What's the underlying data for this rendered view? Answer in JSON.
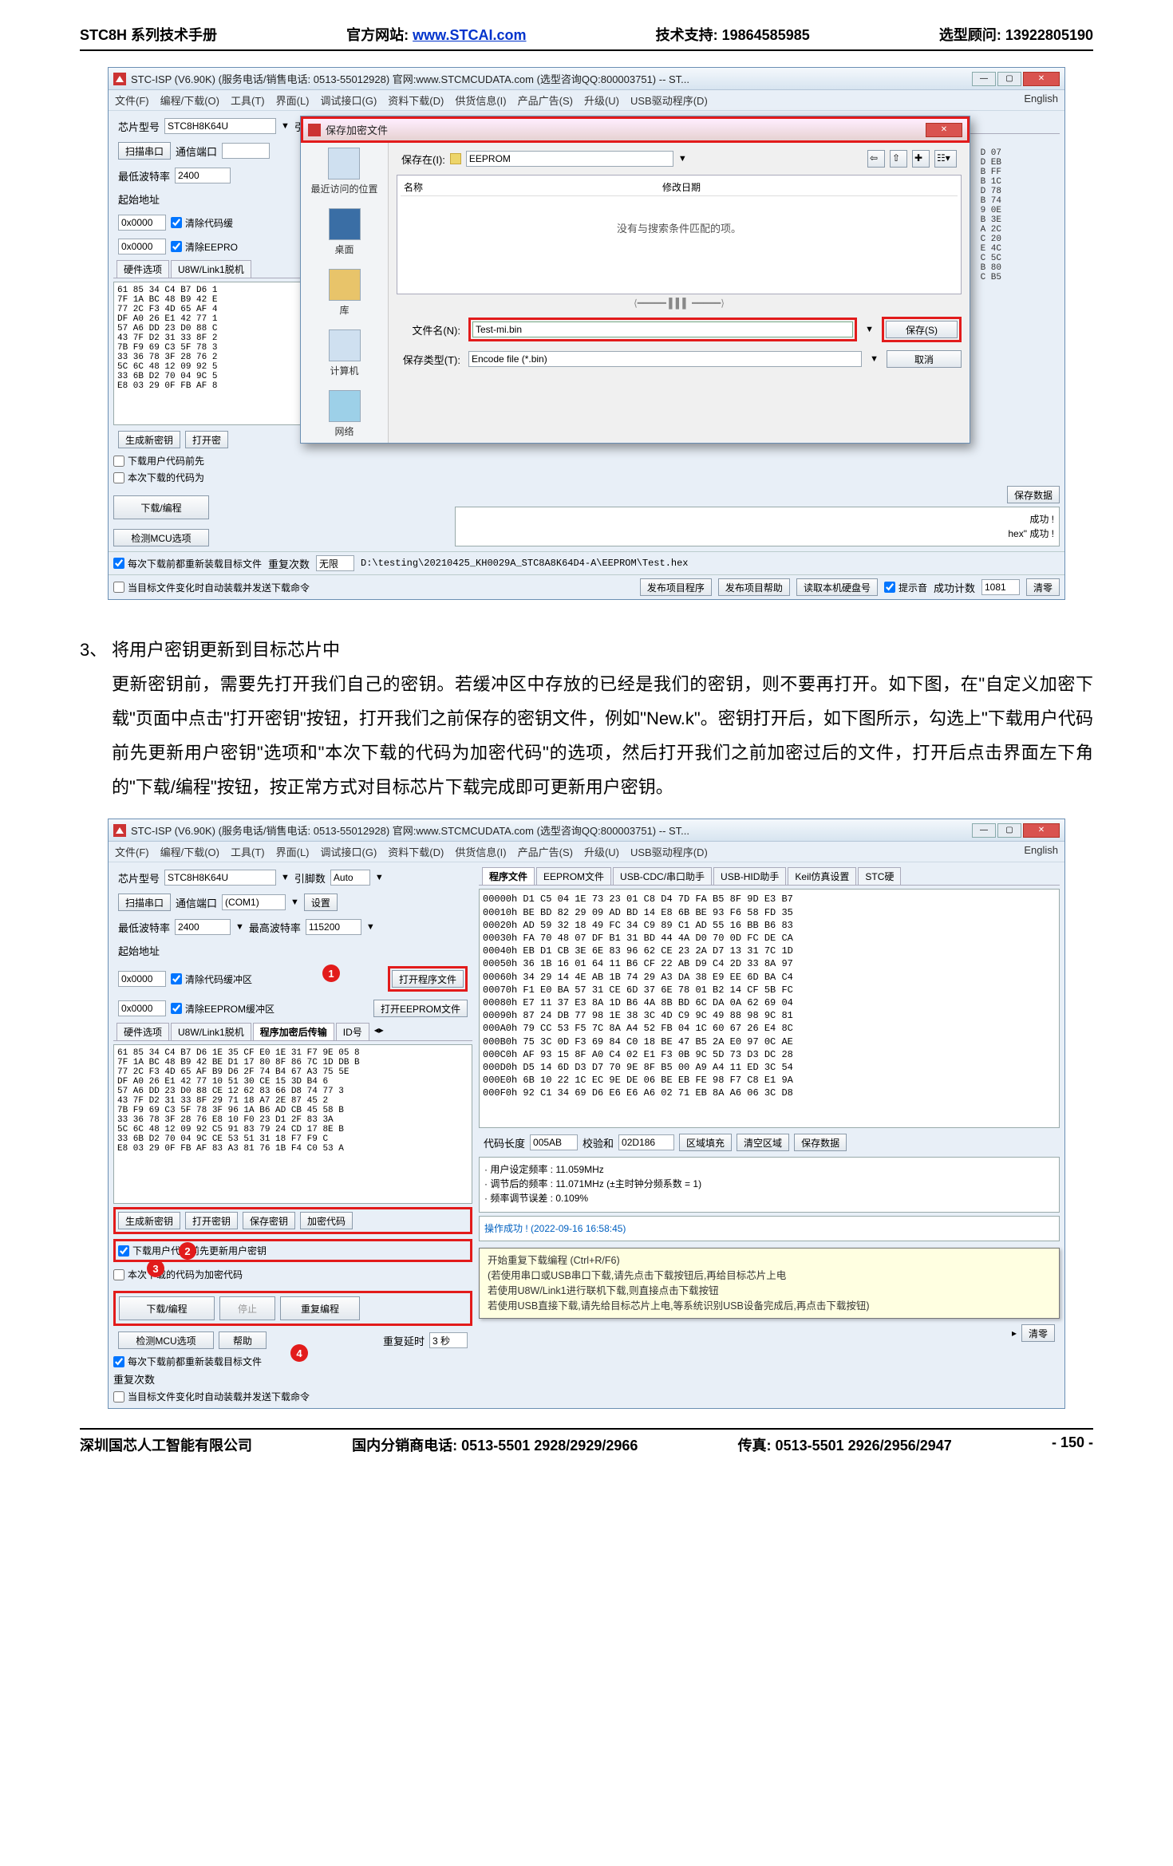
{
  "header": {
    "manual": "STC8H 系列技术手册",
    "site_label": "官方网站: ",
    "site_url": "www.STCAI.com",
    "support": "技术支持: 19864585985",
    "consultant": "选型顾问: 13922805190"
  },
  "footer": {
    "company": "深圳国芯人工智能有限公司",
    "distributor": "国内分销商电话: 0513-5501 2928/2929/2966",
    "fax": "传真: 0513-5501 2926/2956/2947",
    "page": "- 150 -"
  },
  "win_title": "STC-ISP (V6.90K) (服务电话/销售电话: 0513-55012928)  官网:www.STCMCUDATA.com  (选型咨询QQ:800003751) -- ST...",
  "menubar": [
    "文件(F)",
    "编程/下载(O)",
    "工具(T)",
    "界面(L)",
    "调试接口(G)",
    "资料下载(D)",
    "供货信息(I)",
    "产品广告(S)",
    "升级(U)",
    "USB驱动程序(D)",
    "English"
  ],
  "chip_label": "芯片型号",
  "chip_value": "STC8H8K64U",
  "pins_label": "引脚数",
  "pins_value": "Auto",
  "scan_port": "扫描串口",
  "com_port_label": "通信端口",
  "com_port_value": "(COM1)",
  "settings_btn": "设置",
  "min_baud_label": "最低波特率",
  "min_baud_value": "2400",
  "max_baud_label": "最高波特率",
  "max_baud_value": "115200",
  "start_addr_label": "起始地址",
  "addr1": "0x0000",
  "addr2": "0x0000",
  "clear_code_buf": "清除代码缓冲区",
  "clear_eeprom_buf": "清除EEPROM缓冲区",
  "open_prog_file": "打开程序文件",
  "open_eeprom_file": "打开EEPROM文件",
  "hw_tab": "硬件选项",
  "u8w_tab": "U8W/Link1脱机",
  "enc_tab": "程序加密后传输",
  "id_tab": "ID号",
  "hex_block1": "61 85 34 C4 B7 D6 1\n7F 1A BC 48 B9 42 E\n77 2C F3 4D 65 AF 4\nDF A0 26 E1 42 77 1\n57 A6 DD 23 D0 88 C\n43 7F D2 31 33 8F 2\n7B F9 69 C3 5F 78 3\n33 36 78 3F 28 76 2\n5C 6C 48 12 09 92 5\n33 6B D2 70 04 9C 5\nE8 03 29 0F FB AF 8",
  "hex_block2": "61 85 34 C4 B7 D6 1E 35 CF E0 1E 31 F7 9E 05 8\n7F 1A BC 48 B9 42 BE D1 17 80 8F 86 7C 1D DB B\n77 2C F3 4D 65 AF B9 D6 2F 74 B4 67 A3 75 5E\nDF A0 26 E1 42 77 10 51 30 CE 15 3D B4 6\n57 A6 DD 23 D0 88 CE 12 62 83 66 D8 74 77 3\n43 7F D2 31 33 8F 29 71 18 A7 2E 87 45 2\n7B F9 69 C3 5F 78 3F 96 1A B6 AD CB 45 58 B\n33 36 78 3F 28 76 E8 10 F0 23 D1 2F 83 3A\n5C 6C 48 12 09 92 C5 91 83 79 24 CD 17 8E B\n33 6B D2 70 04 9C CE 53 51 31 18 F7 F9 C\nE8 03 29 0F FB AF 83 A3 81 76 1B F4 C0 53 A",
  "right_hex_hdr": "00000h D1 C5 04 1E 73 23 01 C8 D4 7D FA B5 8F 9D E3 B7\n00010h BE BD 82 29 09 AD BD 14 E8 6B BE 93 F6 58 FD 35\n00020h AD 59 32 18 49 FC 34 C9 89 C1 AD 55 16 BB B6 83\n00030h FA 70 48 07 DF B1 31 BD 44 4A D0 70 0D FC DE CA\n00040h EB D1 CB 3E 6E 83 96 62 CE 23 2A D7 13 31 7C 1D\n00050h 36 1B 16 01 64 11 B6 CF 22 AB D9 C4 2D 33 8A 97\n00060h 34 29 14 4E AB 1B 74 29 A3 DA 38 E9 EE 6D BA C4\n00070h F1 E0 BA 57 31 CE 6D 37 6E 78 01 B2 14 CF 5B FC\n00080h E7 11 37 E3 8A 1D B6 4A 8B BD 6C DA 0A 62 69 04\n00090h 87 24 DB 77 98 1E 38 3C 4D C9 9C 49 88 98 9C 81\n000A0h 79 CC 53 F5 7C 8A A4 52 FB 04 1C 60 67 26 E4 8C\n000B0h 75 3C 0D F3 69 84 C0 18 BE 47 B5 2A E0 97 0C AE\n000C0h AF 93 15 8F A0 C4 02 E1 F3 0B 9C 5D 73 D3 DC 28\n000D0h D5 14 6D D3 D7 70 9E 8F B5 00 A9 A4 11 ED 3C 54\n000E0h 6B 10 22 1C EC 9E DE 06 BE EB FE 98 F7 C8 E1 9A\n000F0h 92 C1 34 69 D6 E6 E6 A6 02 71 EB 8A A6 06 3C D8",
  "gen_key": "生成新密钥",
  "open_key": "打开密钥",
  "save_key": "保存密钥",
  "enc_code": "加密代码",
  "download_btn": "下载/编程",
  "stop_btn": "停止",
  "reprogram_btn": "重复编程",
  "detect_mcu": "检测MCU选项",
  "help_btn": "帮助",
  "retry_label": "重复次数",
  "retry_infinite": "无限",
  "retry_delay_label": "重复延时",
  "retry_delay_value": "3 秒",
  "chk_reinstall": "每次下载前都重新装载目标文件",
  "chk_autoload": "当目标文件变化时自动装载并发送下载命令",
  "chk_update_key": "下载用户代码前先更新用户密钥",
  "chk_enc_code": "本次下载的代码为加密代码",
  "chk_sound": "提示音",
  "success_count_label": "成功计数",
  "success_count_value": "1081",
  "clear_btn": "清零",
  "path_text": "D:\\testing\\20210425_KH0029A_STC8A8K64D4-A\\EEPROM\\Test.hex",
  "publish_prog": "发布项目程序",
  "publish_help": "发布项目帮助",
  "read_disk_id": "读取本机硬盘号",
  "right_tabs": [
    "程序文件",
    "EEPROM文件",
    "USB-CDC/串口助手",
    "USB-HID助手",
    "Keil仿真设置",
    "STC硬"
  ],
  "save_dialog": {
    "title": "保存加密文件",
    "save_in_label": "保存在(I):",
    "folder": "EEPROM",
    "col_name": "名称",
    "col_date": "修改日期",
    "empty_text": "没有与搜索条件匹配的项。",
    "places": [
      "最近访问的位置",
      "桌面",
      "库",
      "计算机",
      "网络"
    ],
    "filename_label": "文件名(N):",
    "filename_value": "Test-mi.bin",
    "filetype_label": "保存类型(T):",
    "filetype_value": "Encode file (*.bin)",
    "save_btn": "保存(S)",
    "cancel_btn": "取消",
    "side_hex": "D 07\nD EB\nB FF\nB 1C\nD 78\nB 74\n9 0E\nB 3E\nA 2C\nC 20\nE 4C\nC 5C\nB 80\nC B5"
  },
  "success1": " 成功 !\nhex\" 成功 !",
  "save_data_btn": "保存数据",
  "instruction": {
    "num": "3、",
    "title": "将用户密钥更新到目标芯片中",
    "body": "更新密钥前，需要先打开我们自己的密钥。若缓冲区中存放的已经是我们的密钥，则不要再打开。如下图，在\"自定义加密下载\"页面中点击\"打开密钥\"按钮，打开我们之前保存的密钥文件，例如\"New.k\"。密钥打开后，如下图所示，勾选上\"下载用户代码前先更新用户密钥\"选项和\"本次下载的代码为加密代码\"的选项，然后打开我们之前加密过后的文件，打开后点击界面左下角的\"下载/编程\"按钮，按正常方式对目标芯片下载完成即可更新用户密钥。"
  },
  "code_len_label": "代码长度",
  "code_len_value": "005AB",
  "checksum_label": "校验和",
  "checksum_value": "02D186",
  "fill_area": "区域填充",
  "clear_area": "清空区域",
  "info_lines": "· 用户设定频率 : 11.059MHz\n· 调节后的频率 : 11.071MHz (±主时钟分频系数 = 1)\n· 频率调节误差 : 0.109%",
  "op_success": "操作成功 ! (2022-09-16 16:58:45)",
  "tooltip": {
    "l1": "开始重复下载编程 (Ctrl+R/F6)",
    "l2": "(若使用串口或USB串口下载,请先点击下载按钮后,再给目标芯片上电",
    "l3": "若使用U8W/Link1进行联机下载,则直接点击下载按钮",
    "l4": "若使用USB直接下载,请先给目标芯片上电,等系统识别USB设备完成后,再点击下载按钮)"
  },
  "markers": {
    "m1": "1",
    "m2": "2",
    "m3": "3",
    "m4": "4"
  }
}
